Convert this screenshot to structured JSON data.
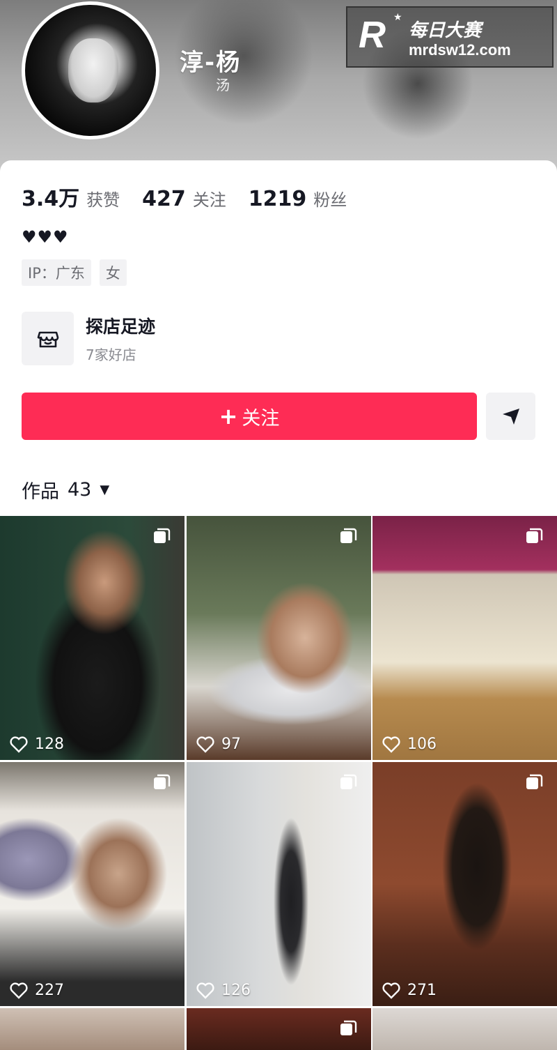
{
  "profile": {
    "nickname": "淳-杨",
    "subname": "汤"
  },
  "watermark": {
    "logo": "R",
    "brand_cn": "每日大赛",
    "url": "mrdsw12.com"
  },
  "stats": {
    "likes_value": "3.4万",
    "likes_label": "获赞",
    "following_value": "427",
    "following_label": "关注",
    "followers_value": "1219",
    "followers_label": "粉丝"
  },
  "bio": "♥♥♥",
  "tags": [
    "IP：广东",
    "女"
  ],
  "footprint": {
    "title": "探店足迹",
    "subtitle": "7家好店",
    "icon": "shop-icon"
  },
  "actions": {
    "follow_label": "关注",
    "follow_plus": "+",
    "share_icon": "send-icon",
    "accent": "#fe2c55"
  },
  "works": {
    "label": "作品",
    "count": "43"
  },
  "posts": [
    {
      "likes": "128",
      "multi": true
    },
    {
      "likes": "97",
      "multi": true
    },
    {
      "likes": "106",
      "multi": true
    },
    {
      "likes": "227",
      "multi": true
    },
    {
      "likes": "126",
      "multi": true
    },
    {
      "likes": "271",
      "multi": true
    },
    {
      "likes": "",
      "multi": false
    },
    {
      "likes": "",
      "multi": true
    },
    {
      "likes": "",
      "multi": false
    }
  ]
}
